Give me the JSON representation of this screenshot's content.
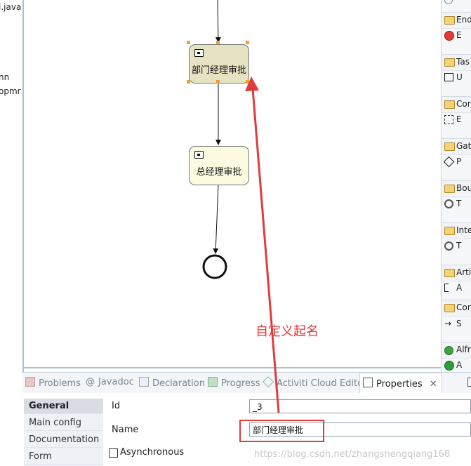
{
  "explorer": {
    "items": [
      "l.java",
      "nn",
      "opmr"
    ]
  },
  "diagram": {
    "task1_label": "部门经理审批",
    "task2_label": "总经理审批"
  },
  "palette": {
    "sections": [
      {
        "header": "End",
        "item": "E"
      },
      {
        "header": "Tas",
        "item": "U"
      },
      {
        "header": "Cor",
        "item": "E"
      },
      {
        "header": "Gat",
        "item": "P"
      },
      {
        "header": "Bou",
        "item": "T"
      },
      {
        "header": "Inte",
        "item": "T"
      },
      {
        "header": "Arti",
        "item": "A"
      },
      {
        "header": "Cor",
        "item": "S"
      },
      {
        "header": "Alfr",
        "item": "A"
      }
    ]
  },
  "tabs": [
    {
      "label": "Problems",
      "icon": "problems-icon"
    },
    {
      "label": "Javadoc",
      "icon": "at-icon"
    },
    {
      "label": "Declaration",
      "icon": "declaration-icon"
    },
    {
      "label": "Progress",
      "icon": "progress-icon"
    },
    {
      "label": "Activiti Cloud Editor",
      "icon": "diamond-icon"
    },
    {
      "label": "Properties",
      "icon": "properties-icon"
    }
  ],
  "properties": {
    "nav": [
      "General",
      "Main config",
      "Documentation",
      "Form"
    ],
    "id_label": "Id",
    "id_value": "_3",
    "name_label": "Name",
    "name_value": "部门经理审批",
    "async_label": "Asynchronous"
  },
  "annotation": {
    "text": "自定义起名",
    "color": "#e03c3c"
  },
  "watermark": "https://blog.csdn.net/zhangshengqiang168"
}
